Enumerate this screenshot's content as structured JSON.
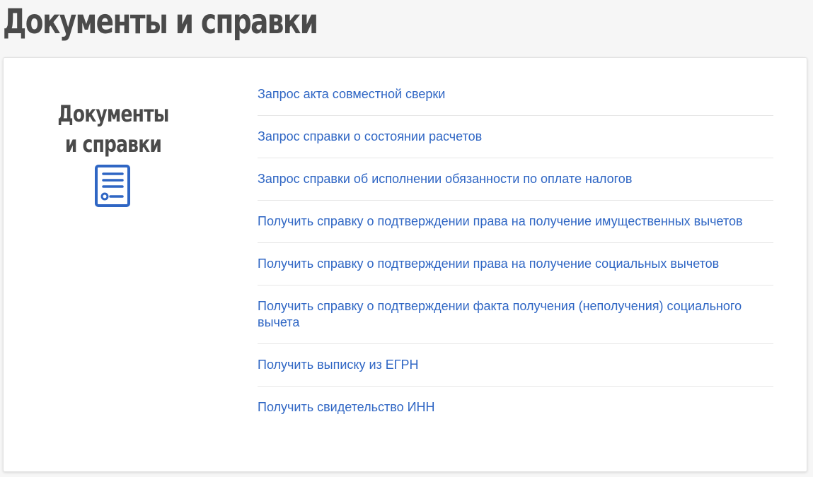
{
  "page": {
    "title": "Документы и справки"
  },
  "section": {
    "title": "Документы и справки",
    "icon": "document-list-icon"
  },
  "links": [
    "Запрос акта совместной сверки",
    "Запрос справки о состоянии расчетов",
    "Запрос справки об исполнении обязанности по оплате налогов",
    "Получить справку о подтверждении права на получение имущественных вычетов",
    "Получить справку о подтверждении права на получение социальных вычетов",
    "Получить справку о подтверждении факта получения (неполучения) социального вычета",
    "Получить выписку из ЕГРН",
    "Получить свидетельство ИНН"
  ],
  "colors": {
    "link": "#2f66c4",
    "title": "#4a4a4a",
    "icon": "#2f66c4",
    "background": "#f6f6f6"
  }
}
